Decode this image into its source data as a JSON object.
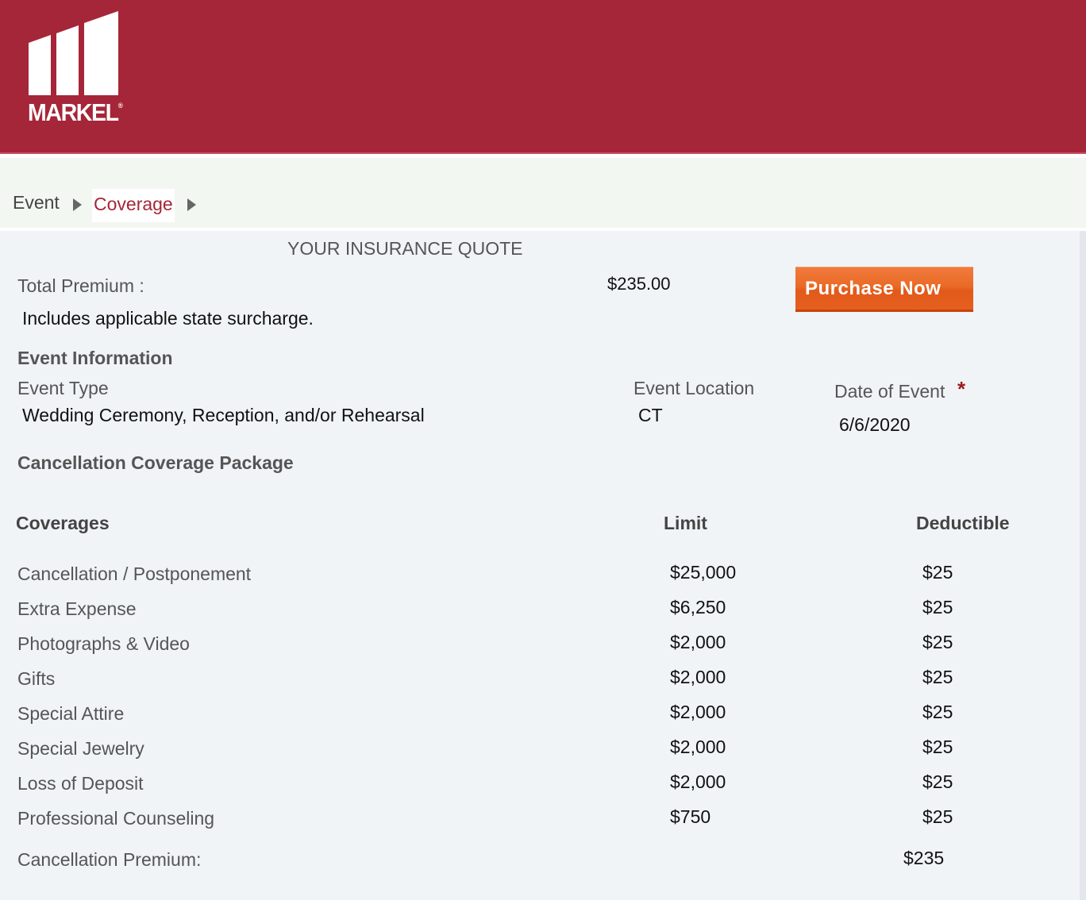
{
  "header": {
    "logo_text": "MARKEL",
    "logo_mark": "®",
    "brand_color": "#a52638"
  },
  "breadcrumb": {
    "items": [
      "Event",
      "Coverage"
    ],
    "active": "Coverage"
  },
  "quote": {
    "title": "YOUR INSURANCE QUOTE",
    "total_premium_label": "Total Premium :",
    "total_premium_value": "$235.00",
    "surcharge_note": "Includes applicable state surcharge.",
    "purchase_label": "Purchase Now",
    "purchase_color": "#e8652a"
  },
  "event_info": {
    "heading": "Event Information",
    "type_label": "Event Type",
    "type_value": "Wedding Ceremony, Reception, and/or Rehearsal",
    "location_label": "Event Location",
    "location_value": "CT",
    "date_label": "Date of Event",
    "required_mark": "*",
    "date_value": "6/6/2020"
  },
  "coverage_package": {
    "heading": "Cancellation Coverage Package",
    "columns": [
      "Coverages",
      "Limit",
      "Deductible"
    ],
    "rows": [
      {
        "name": "Cancellation / Postponement",
        "limit": "$25,000",
        "deductible": "$25"
      },
      {
        "name": "Extra Expense",
        "limit": "$6,250",
        "deductible": "$25"
      },
      {
        "name": "Photographs & Video",
        "limit": "$2,000",
        "deductible": "$25"
      },
      {
        "name": "Gifts",
        "limit": "$2,000",
        "deductible": "$25"
      },
      {
        "name": "Special Attire",
        "limit": "$2,000",
        "deductible": "$25"
      },
      {
        "name": "Special Jewelry",
        "limit": "$2,000",
        "deductible": "$25"
      },
      {
        "name": "Loss of Deposit",
        "limit": "$2,000",
        "deductible": "$25"
      },
      {
        "name": "Professional Counseling",
        "limit": "$750",
        "deductible": "$25"
      }
    ],
    "premium_label": "Cancellation Premium:",
    "premium_value": "$235"
  }
}
